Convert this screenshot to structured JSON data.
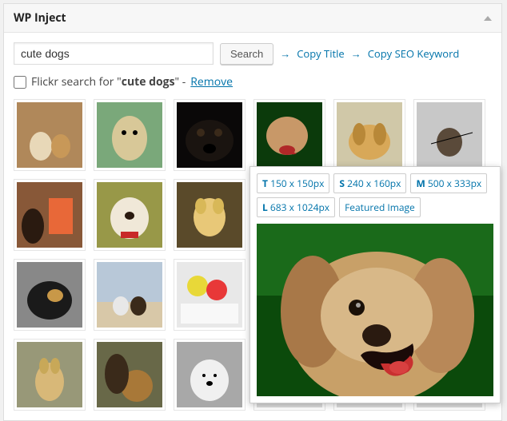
{
  "panel": {
    "title": "WP Inject"
  },
  "search": {
    "value": "cute dogs",
    "button": "Search",
    "copy_title": "Copy Title",
    "copy_seo": "Copy SEO Keyword"
  },
  "source": {
    "prefix": "Flickr search for \"",
    "term": "cute dogs",
    "suffix": "\" - ",
    "remove": "Remove"
  },
  "sizes": {
    "t": "150 x 150px",
    "s": "240 x 160px",
    "m": "500 x 333px",
    "l": "683 x 1024px",
    "featured": "Featured Image"
  }
}
